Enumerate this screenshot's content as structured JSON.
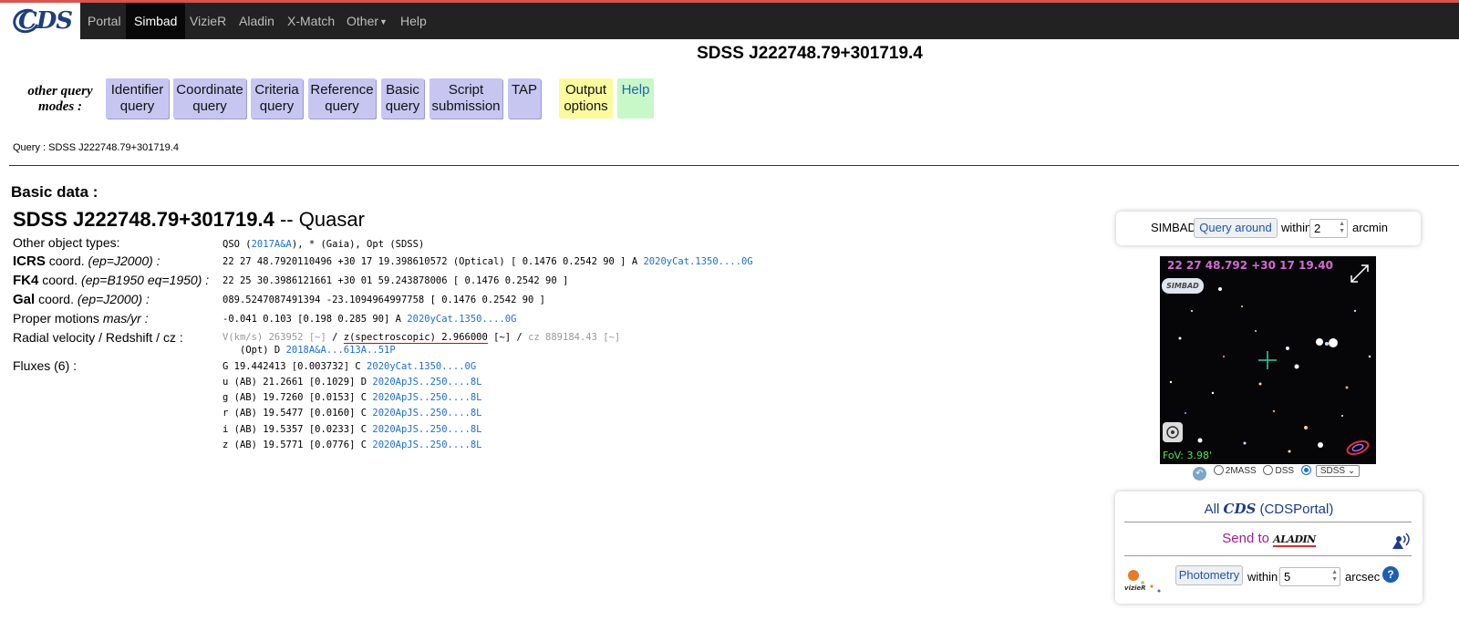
{
  "nav": {
    "items": [
      "Portal",
      "Simbad",
      "VizieR",
      "Aladin",
      "X-Match",
      "Other",
      "Help"
    ],
    "active": "Simbad"
  },
  "title": "SDSS J222748.79+301719.4",
  "query_modes": {
    "label_line1": "other query",
    "label_line2": "modes :",
    "buttons": [
      {
        "l1": "Identifier",
        "l2": "query"
      },
      {
        "l1": "Coordinate",
        "l2": "query"
      },
      {
        "l1": "Criteria",
        "l2": "query"
      },
      {
        "l1": "Reference",
        "l2": "query"
      },
      {
        "l1": "Basic",
        "l2": "query"
      },
      {
        "l1": "Script",
        "l2": "submission"
      },
      {
        "l1": "TAP",
        "l2": ""
      },
      {
        "l1": "Output",
        "l2": "options"
      },
      {
        "l1": "Help",
        "l2": ""
      }
    ]
  },
  "query_text": "Query : SDSS J222748.79+301719.4",
  "basic_data": {
    "header": "Basic data :",
    "object_name": "SDSS J222748.79+301719.4",
    "object_type": "-- Quasar",
    "other_types_label": "Other object types:",
    "other_types": {
      "a": "QSO (",
      "ref": "2017A&A",
      "b": "), * (Gaia), Opt (SDSS)"
    },
    "icrs": {
      "name": "ICRS",
      "mid": " coord. ",
      "ep": "(ep=J2000) :",
      "value": "22 27 48.7920110496 +30 17 19.398610572 (Optical) [ 0.1476 0.2542 90 ] A ",
      "ref": "2020yCat.1350....0G"
    },
    "fk4": {
      "name": "FK4",
      "mid": " coord. ",
      "ep": "(ep=B1950 eq=1950) :",
      "value": "22 25 30.3986121661 +30 01 59.243878006 [ 0.1476 0.2542 90 ]"
    },
    "gal": {
      "name": "Gal",
      "mid": " coord. ",
      "ep": "(ep=J2000) :",
      "value": "089.5247087491394 -23.1094964997758 [ 0.1476 0.2542 90 ]"
    },
    "pm": {
      "label": "Proper motions ",
      "unit": "mas/yr :",
      "value": "-0.041 0.103 [0.198 0.285 90] A ",
      "ref": "2020yCat.1350....0G"
    },
    "rv": {
      "label": "Radial velocity / Redshift / cz :",
      "v": "V(km/s) 263952 [~]",
      "sep1": " / ",
      "z": "z(spectroscopic) 2.966000",
      "z_err": " [~] / ",
      "cz": "cz 889184.43 [~]",
      "line2": "(Opt) D ",
      "ref": "2018A&A...613A..51P"
    },
    "fluxes_label": "Fluxes (6) :",
    "fluxes": [
      {
        "text": "G 19.442413 [0.003732] C ",
        "ref": "2020yCat.1350....0G"
      },
      {
        "text": "u (AB) 21.2661 [0.1029] D ",
        "ref": "2020ApJS..250....8L"
      },
      {
        "text": "g (AB) 19.7260 [0.0153] C ",
        "ref": "2020ApJS..250....8L"
      },
      {
        "text": "r (AB) 19.5477 [0.0160] C ",
        "ref": "2020ApJS..250....8L"
      },
      {
        "text": "i (AB) 19.5357 [0.0233] C ",
        "ref": "2020ApJS..250....8L"
      },
      {
        "text": "z (AB) 19.5771 [0.0776] C ",
        "ref": "2020ApJS..250....8L"
      }
    ]
  },
  "side": {
    "simbad_label": "SIMBAD",
    "query_around": "Query around",
    "within": "within",
    "radius_value": "2",
    "unit_arcmin": "arcmin",
    "sky_coord": "22 27 48.792 +30 17 19.40",
    "simbad_tag": "SIMBAD",
    "fov": "FoV: 3.98'",
    "surveys": [
      "2MASS",
      "DSS",
      "SDSS"
    ],
    "survey_selected": "SDSS",
    "all": "All",
    "cds": "CDS",
    "cdsportal": "(CDSPortal)",
    "send_to": "Send to",
    "aladin": "ALADIN",
    "photometry": "Photometry",
    "within2": "within",
    "phot_value": "5",
    "unit_arcsec": "arcsec",
    "vizier_tag": "vizieR"
  },
  "colors": {
    "link": "#1e6fcf",
    "mode_blue": "#c6c6f1",
    "mode_yellow": "#fbfb9e",
    "mode_green": "#c8f7c8",
    "nav_bg": "#222222"
  }
}
